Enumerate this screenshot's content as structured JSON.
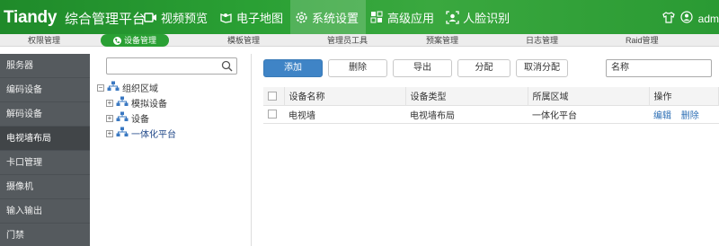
{
  "header": {
    "brand": "Tiandy",
    "product": "综合管理平台",
    "nav": [
      {
        "label": "视频预览",
        "icon": "video-icon"
      },
      {
        "label": "电子地图",
        "icon": "map-icon"
      },
      {
        "label": "系统设置",
        "icon": "gear-icon"
      },
      {
        "label": "高级应用",
        "icon": "grid-icon"
      },
      {
        "label": "人脸识别",
        "icon": "face-icon"
      }
    ],
    "user": "adm"
  },
  "subtabs": [
    "权限管理",
    "设备管理",
    "模板管理",
    "管理员工具",
    "预案管理",
    "日志管理",
    "Raid管理"
  ],
  "sidebar": {
    "items": [
      "服务器",
      "编码设备",
      "解码设备",
      "电视墙布局",
      "卡口管理",
      "摄像机",
      "输入输出",
      "门禁"
    ]
  },
  "tree": {
    "root": "组织区域",
    "children": [
      "模拟设备",
      "设备",
      "一体化平台"
    ]
  },
  "toolbar": {
    "add": "添加",
    "delete": "删除",
    "export": "导出",
    "assign": "分配",
    "unassign": "取消分配",
    "search_value": "名称"
  },
  "table": {
    "columns": [
      "设备名称",
      "设备类型",
      "所属区域",
      "操作"
    ],
    "rows": [
      {
        "name": "电视墙",
        "type": "电视墙布局",
        "area": "一体化平台",
        "edit": "编辑",
        "delete": "删除"
      }
    ]
  },
  "colors": {
    "brand_green": "#2aa034",
    "primary_blue": "#3f84c6",
    "sidebar": "#555a5e"
  }
}
